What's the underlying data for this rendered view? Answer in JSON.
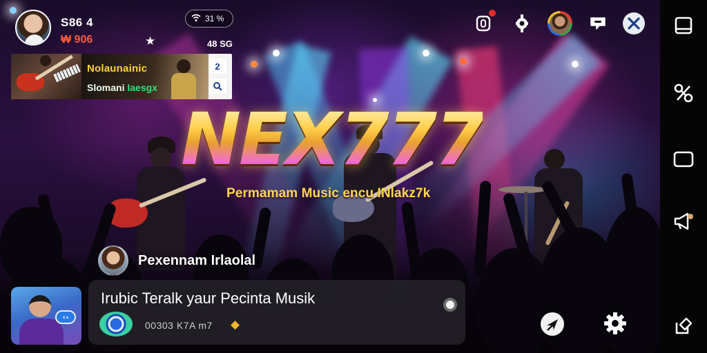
{
  "status": {
    "main": "S86 4",
    "sub": "₩ 906",
    "star": "★",
    "count": "48 SG",
    "signal_text": "31 %"
  },
  "now_playing": {
    "title": "Nolaunainic",
    "artist_prefix": "Slomani ",
    "artist_highlight": "Iaesgx",
    "button_num": "2"
  },
  "logo": {
    "text": "NEX777",
    "tagline": "Permamam Music encu INlakz7k"
  },
  "host": {
    "name": "Pexennam Irlaolal"
  },
  "comment": {
    "text": "Irubic Teralk yaur Pecinta Musik",
    "meta": "00303 K7A m7"
  },
  "colors": {
    "accent_gold": "#ffd23c",
    "accent_green": "#35e07a",
    "alert_red": "#ff5a3c",
    "navbar_bg": "#050505"
  },
  "icons": {
    "top": [
      "notification-icon",
      "gear-icon",
      "profile-avatar",
      "chat-bubble-icon",
      "close-icon"
    ],
    "nav": [
      "square-tab-icon",
      "scissors-icon",
      "window-icon",
      "megaphone-icon",
      "tag-icon"
    ],
    "bottom": [
      "share-icon",
      "settings-icon"
    ]
  }
}
